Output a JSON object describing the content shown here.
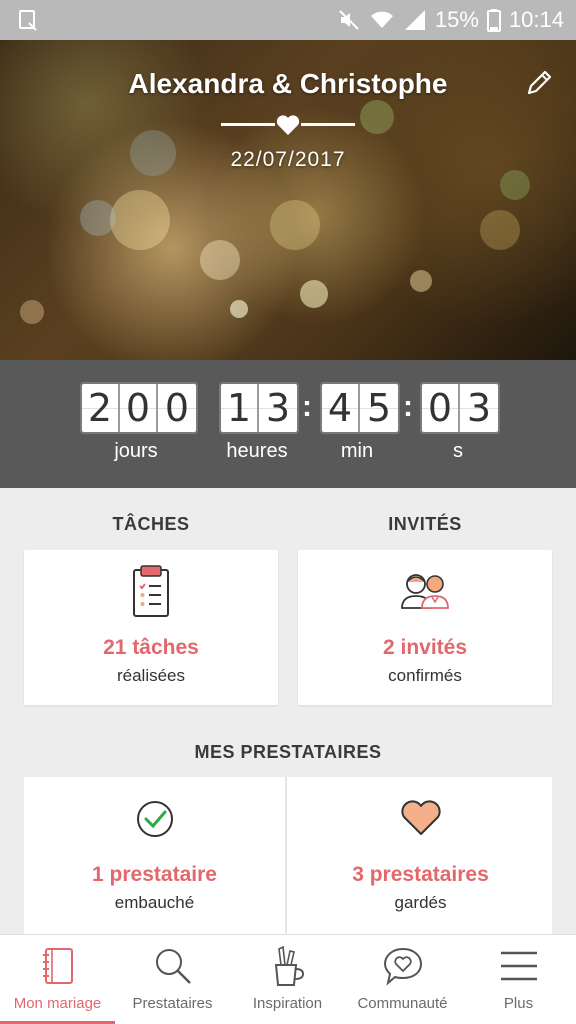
{
  "status_bar": {
    "battery": "15%",
    "time": "10:14",
    "icons": [
      "notification-icon",
      "mute-icon",
      "wifi-icon",
      "signal-icon",
      "battery-icon"
    ]
  },
  "header": {
    "couple": "Alexandra & Christophe",
    "date": "22/07/2017",
    "edit_icon": "pencil-icon"
  },
  "countdown": {
    "days": [
      "2",
      "0",
      "0"
    ],
    "hours": [
      "1",
      "3"
    ],
    "minutes": [
      "4",
      "5"
    ],
    "seconds": [
      "0",
      "3"
    ],
    "separator": ":",
    "labels": {
      "days": "jours",
      "hours": "heures",
      "minutes": "min",
      "seconds": "s"
    }
  },
  "tasks": {
    "title": "TÂCHES",
    "count": "21 tâches",
    "status": "réalisées",
    "icon": "clipboard-icon"
  },
  "guests": {
    "title": "INVITÉS",
    "count": "2 invités",
    "status": "confirmés",
    "icon": "guests-icon"
  },
  "vendors": {
    "title": "MES PRESTATAIRES",
    "hired": {
      "count": "1 prestataire",
      "status": "embauché",
      "icon": "check-circle-icon"
    },
    "saved": {
      "count": "3 prestataires",
      "status": "gardés",
      "icon": "heart-icon"
    }
  },
  "nav": {
    "items": [
      {
        "label": "Mon mariage",
        "icon": "notebook-icon",
        "active": true
      },
      {
        "label": "Prestataires",
        "icon": "search-icon",
        "active": false
      },
      {
        "label": "Inspiration",
        "icon": "pencil-cup-icon",
        "active": false
      },
      {
        "label": "Communauté",
        "icon": "chat-heart-icon",
        "active": false
      },
      {
        "label": "Plus",
        "icon": "menu-icon",
        "active": false
      }
    ]
  },
  "colors": {
    "accent": "#e2686d",
    "countdown_bg": "#595959",
    "page_bg": "#ededed",
    "status_bar_bg": "#b9b9b9"
  }
}
